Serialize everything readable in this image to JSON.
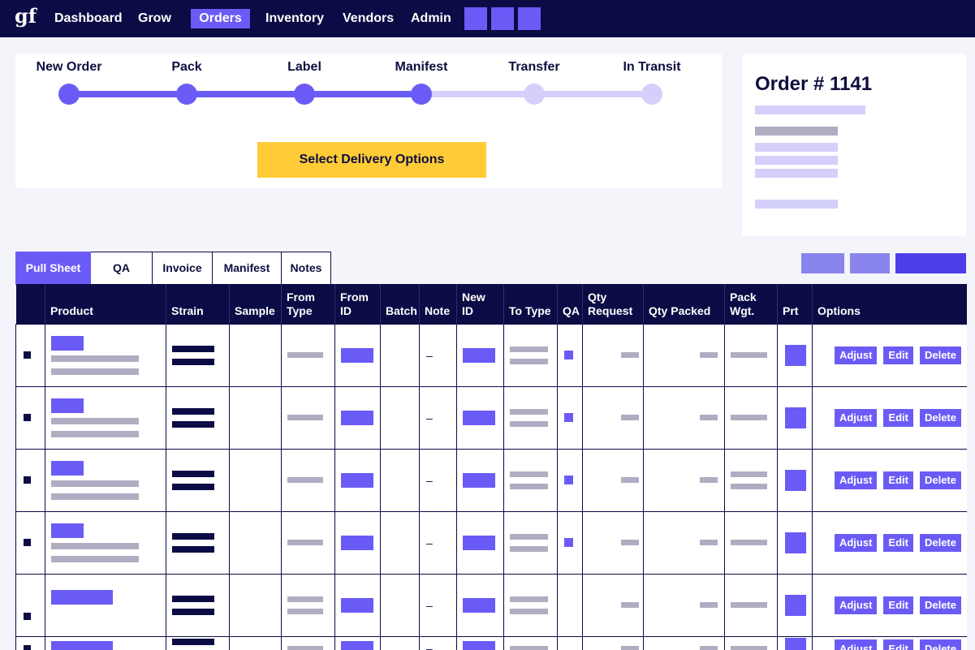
{
  "nav": {
    "logo": "gf",
    "items": [
      "Dashboard",
      "Grow",
      "Orders",
      "Inventory",
      "Vendors",
      "Admin"
    ],
    "active": "Orders"
  },
  "progress": {
    "steps": [
      "New Order",
      "Pack",
      "Label",
      "Manifest",
      "Transfer",
      "In Transit"
    ],
    "current_step": "Manifest",
    "button_label": "Select Delivery Options"
  },
  "order": {
    "title": "Order # 1141"
  },
  "tabs": [
    "Pull Sheet",
    "QA",
    "Invoice",
    "Manifest",
    "Notes"
  ],
  "active_tab": "Pull Sheet",
  "table": {
    "headers": {
      "product": "Product",
      "strain": "Strain",
      "sample": "Sample",
      "from_type": "From Type",
      "from_id": "From ID",
      "batch": "Batch",
      "note": "Note",
      "new_id": "New ID",
      "to_type": "To Type",
      "qa": "QA",
      "qty_request": "Qty Request",
      "qty_packed": "Qty Packed",
      "pack_wgt": "Pack Wgt.",
      "prt": "Prt",
      "options": "Options"
    },
    "note_placeholder": "–",
    "row_buttons": {
      "adjust": "Adjust",
      "edit": "Edit",
      "delete": "Delete"
    }
  },
  "colors": {
    "navy": "#0b0b45",
    "accent": "#6b5bf6",
    "accent_light": "#d4d0fb",
    "yellow": "#ffcb37",
    "placeholder_grey": "#b0adc3"
  }
}
